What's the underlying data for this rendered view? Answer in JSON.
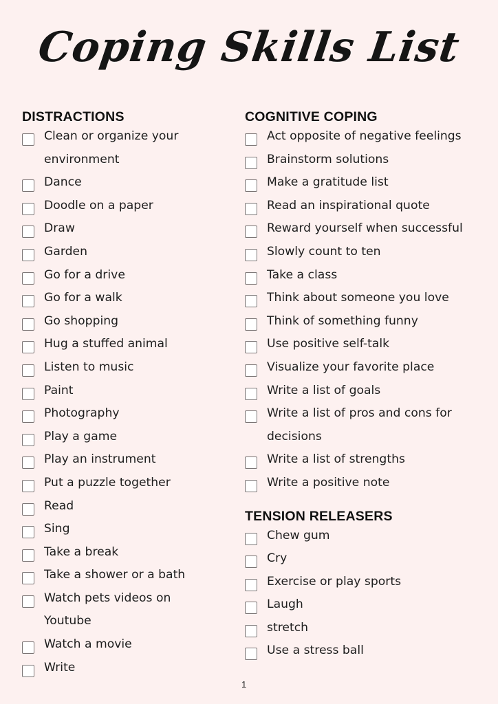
{
  "title": "Coping Skills List",
  "page_number": "1",
  "sections": {
    "distractions": {
      "heading": "DISTRACTIONS",
      "items": [
        "Clean or organize your",
        "environment",
        "Dance",
        "Doodle on a paper",
        "Draw",
        "Garden",
        "Go for a drive",
        "Go for a walk",
        "Go shopping",
        "Hug a stuffed animal",
        "Listen to music",
        "Paint",
        "Photography",
        "Play a game",
        "Play an instrument",
        "Put a puzzle together",
        "Read",
        "Sing",
        "Take a break",
        "Take a shower or a bath",
        "Watch pets videos on",
        "Youtube",
        "Watch a movie",
        "Write"
      ]
    },
    "cognitive": {
      "heading": "COGNITIVE COPING",
      "items": [
        "Act opposite of negative feelings",
        "Brainstorm solutions",
        "Make a gratitude list",
        "Read an inspirational quote",
        "Reward yourself when successful",
        "Slowly count to ten",
        "Take a class",
        "Think about someone you love",
        "Think of something funny",
        "Use positive self-talk",
        "Visualize your favorite place",
        "Write a list of goals",
        "Write a list of pros and cons for",
        "decisions",
        "Write a list of strengths",
        "Write a positive note"
      ]
    },
    "tension": {
      "heading": "TENSION RELEASERS",
      "items": [
        "Chew gum",
        "Cry",
        "Exercise or play sports",
        "Laugh",
        "stretch",
        "Use a stress ball"
      ]
    }
  }
}
